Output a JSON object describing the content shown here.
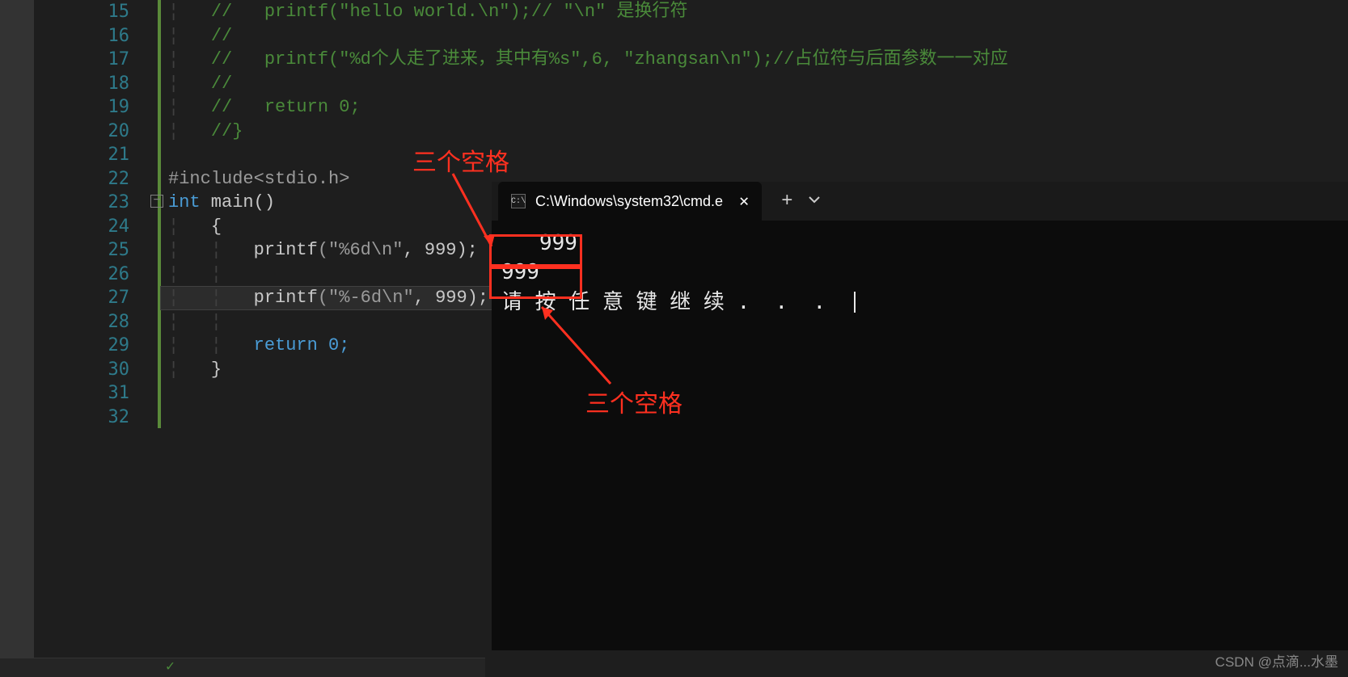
{
  "editor": {
    "line_numbers": [
      "15",
      "16",
      "17",
      "18",
      "19",
      "20",
      "21",
      "22",
      "23",
      "24",
      "25",
      "26",
      "27",
      "28",
      "29",
      "30",
      "31",
      "32"
    ],
    "lines": {
      "l15": "//   printf(\"hello world.\\n\");// \"\\n\" 是换行符",
      "l16": "//",
      "l17": "//   printf(\"%d个人走了进来，其中有%s\",6, \"zhangsan\\n\");//占位符与后面参数一一对应",
      "l18": "//",
      "l19": "//   return 0;",
      "l20": "//}",
      "l21": "",
      "l22_include": "#include",
      "l22_header": "<stdio.h>",
      "l23_type": "int",
      "l23_name": " main",
      "l23_paren": "()",
      "l24": "{",
      "l25_fn": "printf",
      "l25_str": "(\"%6d\\n\"",
      "l25_args": ", 999);",
      "l26": "",
      "l27_fn": "printf",
      "l27_str": "(\"%-6d\\n\"",
      "l27_args": ", 999);",
      "l28": "",
      "l29": "return 0;",
      "l30": "}",
      "l31": "",
      "l32": ""
    },
    "fold_marker": "−"
  },
  "terminal": {
    "tab_title": "C:\\Windows\\system32\\cmd.e",
    "tab_icon": "C:\\",
    "output_line1": "   999",
    "output_line2": "999",
    "prompt": "请 按 任 意 键 继 续 .  .  .  "
  },
  "annotations": {
    "top_label": "三个空格",
    "bottom_label": "三个空格"
  },
  "watermark": "CSDN @点滴...水墨"
}
